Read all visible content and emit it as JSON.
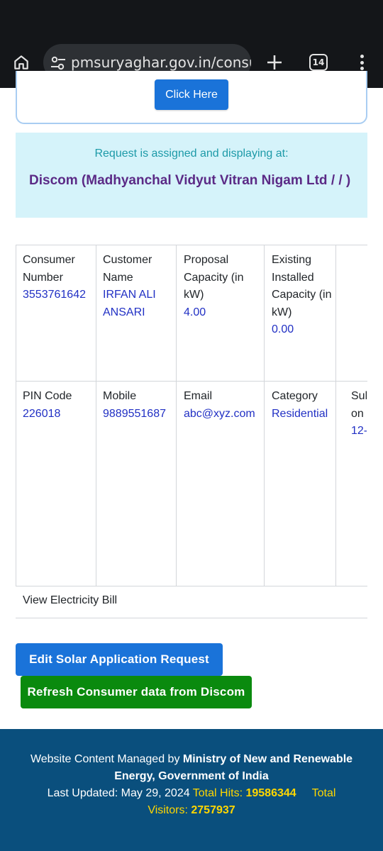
{
  "browser": {
    "url": "pmsuryaghar.gov.in/consum",
    "tab_count": "14"
  },
  "top_card": {
    "button_label": "Click Here"
  },
  "assignment": {
    "line1": "Request is assigned and displaying at:",
    "line2": "Discom (Madhyanchal Vidyut Vitran Nigam Ltd / / )"
  },
  "details": {
    "row1": [
      {
        "label": "Consumer Number",
        "value": "3553761642"
      },
      {
        "label": "Customer Name",
        "value": "IRFAN ALI ANSARI"
      },
      {
        "label": "Proposal Capacity (in kW)",
        "value": "4.00"
      },
      {
        "label": "Existing Installed Capacity (in kW)",
        "value": "0.00"
      }
    ],
    "row2": [
      {
        "label": "PIN Code",
        "value": "226018"
      },
      {
        "label": "Mobile",
        "value": "9889551687"
      },
      {
        "label": "Email",
        "value": "abc@xyz.com"
      },
      {
        "label": "Category",
        "value": "Residential"
      },
      {
        "label": "Sul on",
        "value": "12-"
      }
    ],
    "view_bill": "View Electricity Bill"
  },
  "actions": {
    "edit_label": "Edit Solar Application Request",
    "refresh_label": "Refresh Consumer data from Discom"
  },
  "footer": {
    "managed_prefix": "Website Content Managed by ",
    "managed_org": "Ministry of New and Renewable Energy, Government of India",
    "updated_label": "Last Updated: May 29, 2024",
    "hits_label": "Total Hits:",
    "hits_value": "19586344",
    "visitors_label": "Total Visitors:",
    "visitors_value": "2757937"
  },
  "colors": {
    "primary_button": "#1a73d9",
    "success_button": "#0a8a0e",
    "footer_bg": "#0a4f7d",
    "value_text": "#2130c4",
    "alert_bg": "#d5f3fa",
    "alert_heading": "#5b2a86",
    "highlight": "#ffd600"
  },
  "icons": [
    "home-icon",
    "site-info-icon",
    "plus-icon",
    "tab-switcher-icon",
    "more-vert-icon"
  ]
}
